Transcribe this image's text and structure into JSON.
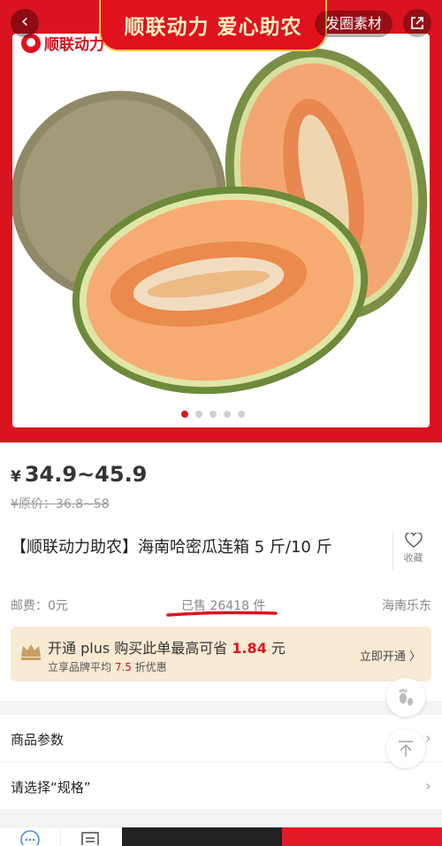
{
  "hero": {
    "banner_text": "顺联动力 爱心助农",
    "logo_text": "顺联动力",
    "material_button": "发圈素材",
    "dot_count": 5,
    "active_dot": 0
  },
  "product": {
    "currency": "¥",
    "price_range": "34.9~45.9",
    "original_price": "¥原价：36.8~58",
    "title": "【顺联动力助农】海南哈密瓜连箱 5 斤/10 斤",
    "favorite_label": "收藏",
    "shipping": "邮费：0元",
    "sold": "已售 26418 件",
    "origin": "海南乐东"
  },
  "plus": {
    "line1_prefix": "开通 plus 购买此单最高可省 ",
    "line1_amount": "1.84",
    "line1_suffix": " 元",
    "line2_prefix": "立享品牌平均 ",
    "line2_discount": "7.5",
    "line2_suffix": " 折优惠",
    "open_label": "立即开通 〉"
  },
  "rows": {
    "params_label": "商品参数",
    "spec_label": "请选择“规格”"
  },
  "colors": {
    "brand_red": "#e0121e",
    "plus_card_bg": "#f8ead3",
    "cart_button_bg": "#222222",
    "buy_button_bg": "#e21a2a"
  },
  "icons": [
    "back-icon",
    "share-icon",
    "heart-icon",
    "footprint-icon",
    "back-to-top-icon",
    "chevron-right-icon",
    "chat-icon",
    "store-icon",
    "crown-icon"
  ]
}
